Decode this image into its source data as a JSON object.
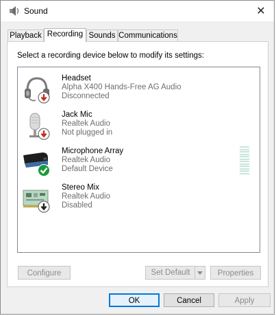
{
  "window": {
    "title": "Sound",
    "close_glyph": "✕"
  },
  "tabs": [
    {
      "label": "Playback",
      "active": false
    },
    {
      "label": "Recording",
      "active": true
    },
    {
      "label": "Sounds",
      "active": false
    },
    {
      "label": "Communications",
      "active": false
    }
  ],
  "instruction": "Select a recording device below to modify its settings:",
  "devices": [
    {
      "name": "Headset",
      "line2": "Alpha X400 Hands-Free AG Audio",
      "line3": "Disconnected",
      "icon": "headset-icon",
      "badge": "disconnected-badge-icon"
    },
    {
      "name": "Jack Mic",
      "line2": "Realtek Audio",
      "line3": "Not plugged in",
      "icon": "microphone-icon",
      "badge": "not-plugged-badge-icon"
    },
    {
      "name": "Microphone Array",
      "line2": "Realtek Audio",
      "line3": "Default Device",
      "icon": "microphone-array-icon",
      "badge": "default-check-icon"
    },
    {
      "name": "Stereo Mix",
      "line2": "Realtek Audio",
      "line3": "Disabled",
      "icon": "sound-card-icon",
      "badge": "disabled-badge-icon"
    }
  ],
  "buttons": {
    "configure": "Configure",
    "set_default": "Set Default",
    "properties": "Properties",
    "ok": "OK",
    "cancel": "Cancel",
    "apply": "Apply"
  },
  "colors": {
    "accent": "#0078d7",
    "badge_red": "#c42b1c",
    "badge_green": "#1a9a3a",
    "level_meter": "#c6e6d9"
  }
}
